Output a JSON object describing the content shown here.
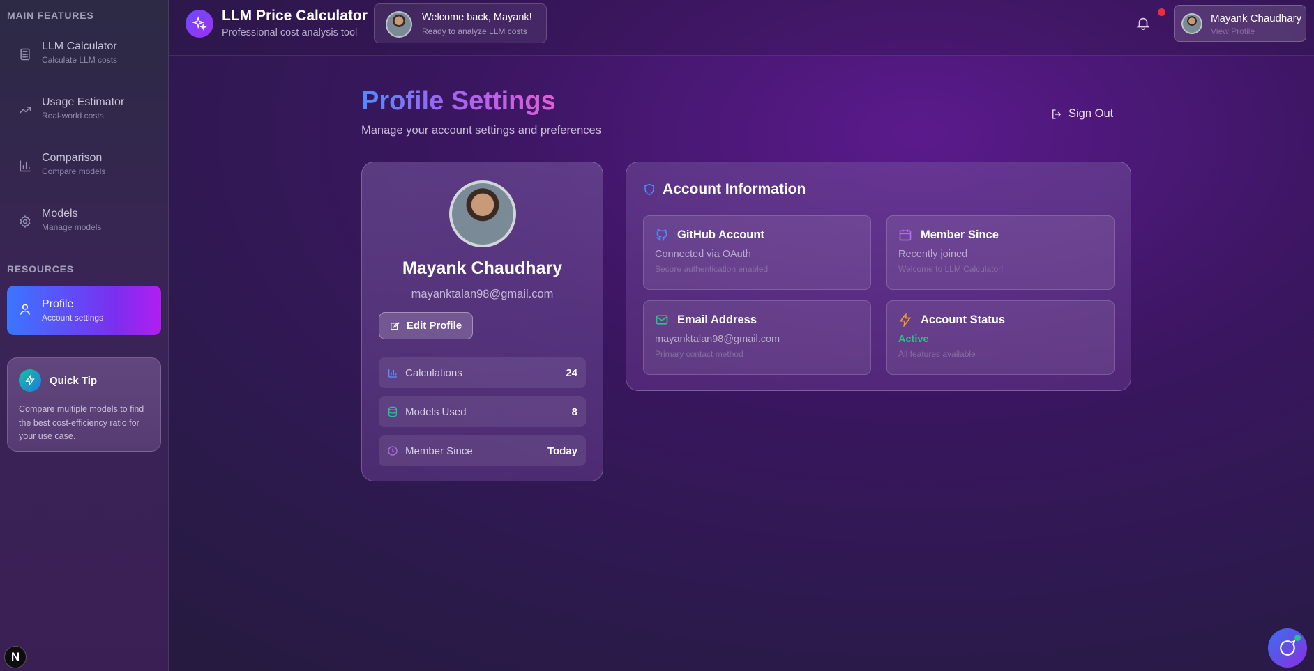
{
  "sidebar": {
    "main_title": "MAIN FEATURES",
    "items": [
      {
        "label": "LLM Calculator",
        "sub": "Calculate LLM costs",
        "icon": "calculator-icon"
      },
      {
        "label": "Usage Estimator",
        "sub": "Real-world costs",
        "icon": "trending-up-icon"
      },
      {
        "label": "Comparison",
        "sub": "Compare models",
        "icon": "bar-chart-icon"
      },
      {
        "label": "Models",
        "sub": "Manage models",
        "icon": "gear-icon"
      }
    ],
    "resources_title": "RESOURCES",
    "active_item": {
      "label": "Profile",
      "sub": "Account settings",
      "icon": "user-icon"
    },
    "tip": {
      "title": "Quick Tip",
      "text": "Compare multiple models to find the best cost-efficiency ratio for your use case.",
      "icon": "lightning-icon"
    },
    "badge": "N"
  },
  "header": {
    "app_title": "LLM Price Calculator",
    "app_subtitle": "Professional cost analysis tool",
    "welcome_title": "Welcome back, Mayank!",
    "welcome_sub": "Ready to analyze LLM costs",
    "user_name": "Mayank Chaudhary",
    "user_sub": "View Profile"
  },
  "main": {
    "title": "Profile Settings",
    "subtitle": "Manage your account settings and preferences",
    "sign_out": "Sign Out",
    "profile": {
      "name": "Mayank Chaudhary",
      "email": "mayanktalan98@gmail.com",
      "edit_label": "Edit Profile",
      "stats": [
        {
          "label": "Calculations",
          "value": "24"
        },
        {
          "label": "Models Used",
          "value": "8"
        },
        {
          "label": "Member Since",
          "value": "Today"
        }
      ]
    },
    "account": {
      "title": "Account Information",
      "github": {
        "title": "GitHub Account",
        "line": "Connected via OAuth",
        "sub": "Secure authentication enabled"
      },
      "member": {
        "title": "Member Since",
        "line": "Recently joined",
        "sub": "Welcome to LLM Calculator!"
      },
      "email": {
        "title": "Email Address",
        "line": "mayanktalan98@gmail.com",
        "sub": "Primary contact method"
      },
      "status": {
        "title": "Account Status",
        "line": "Active",
        "sub": "All features available"
      }
    }
  },
  "colors": {
    "accent_blue": "#3a76ff",
    "accent_purple": "#b01ff0",
    "active_green": "#22c58b",
    "notification_red": "#f02b3c"
  }
}
